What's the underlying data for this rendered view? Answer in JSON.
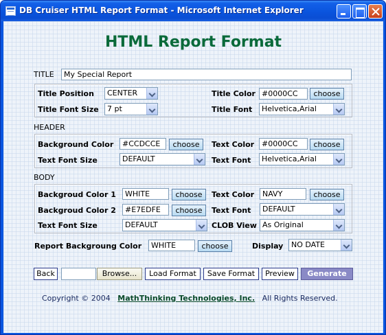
{
  "window": {
    "title": "DB Cruiser HTML Report Format - Microsoft Internet Explorer"
  },
  "page": {
    "heading": "HTML Report Format"
  },
  "title_section": {
    "label": "TITLE",
    "value": "My Special Report",
    "position_label": "Title Position",
    "position_value": "CENTER",
    "color_label": "Title Color",
    "color_value": "#0000CC",
    "font_size_label": "Title Font Size",
    "font_size_value": "7 pt",
    "font_label": "Title Font",
    "font_value": "Helvetica,Arial"
  },
  "header_section": {
    "label": "HEADER",
    "bg_color_label": "Background Color",
    "bg_color_value": "#CCDCCE",
    "text_color_label": "Text Color",
    "text_color_value": "#0000CC",
    "font_size_label": "Text Font Size",
    "font_size_value": "DEFAULT",
    "font_label": "Text Font",
    "font_value": "Helvetica,Arial"
  },
  "body_section": {
    "label": "BODY",
    "bg1_label": "Backgroud Color 1",
    "bg1_value": "WHITE",
    "text_color_label": "Text Color",
    "text_color_value": "NAVY",
    "bg2_label": "Backgroud Color 2",
    "bg2_value": "#E7EDFE",
    "font_label": "Text Font",
    "font_value": "DEFAULT",
    "font_size_label": "Text Font Size",
    "font_size_value": "DEFAULT",
    "clob_label": "CLOB View",
    "clob_value": "As Original"
  },
  "report": {
    "bg_label": "Report Backgroung Color",
    "bg_value": "WHITE",
    "display_label": "Display",
    "display_value": "NO DATE"
  },
  "buttons": {
    "choose": "choose",
    "back": "Back",
    "browse": "Browse...",
    "load": "Load Format",
    "save": "Save Format",
    "preview": "Preview",
    "generate": "Generate"
  },
  "footer": {
    "prefix": "Copyright © 2004",
    "company": "MathThinking Technologies, Inc.",
    "suffix": "All Rights Reserved."
  },
  "colors": {
    "heading": "#0a6a3a",
    "titlebar": "#0a54dd",
    "generate_button": "#8a8ac6"
  }
}
